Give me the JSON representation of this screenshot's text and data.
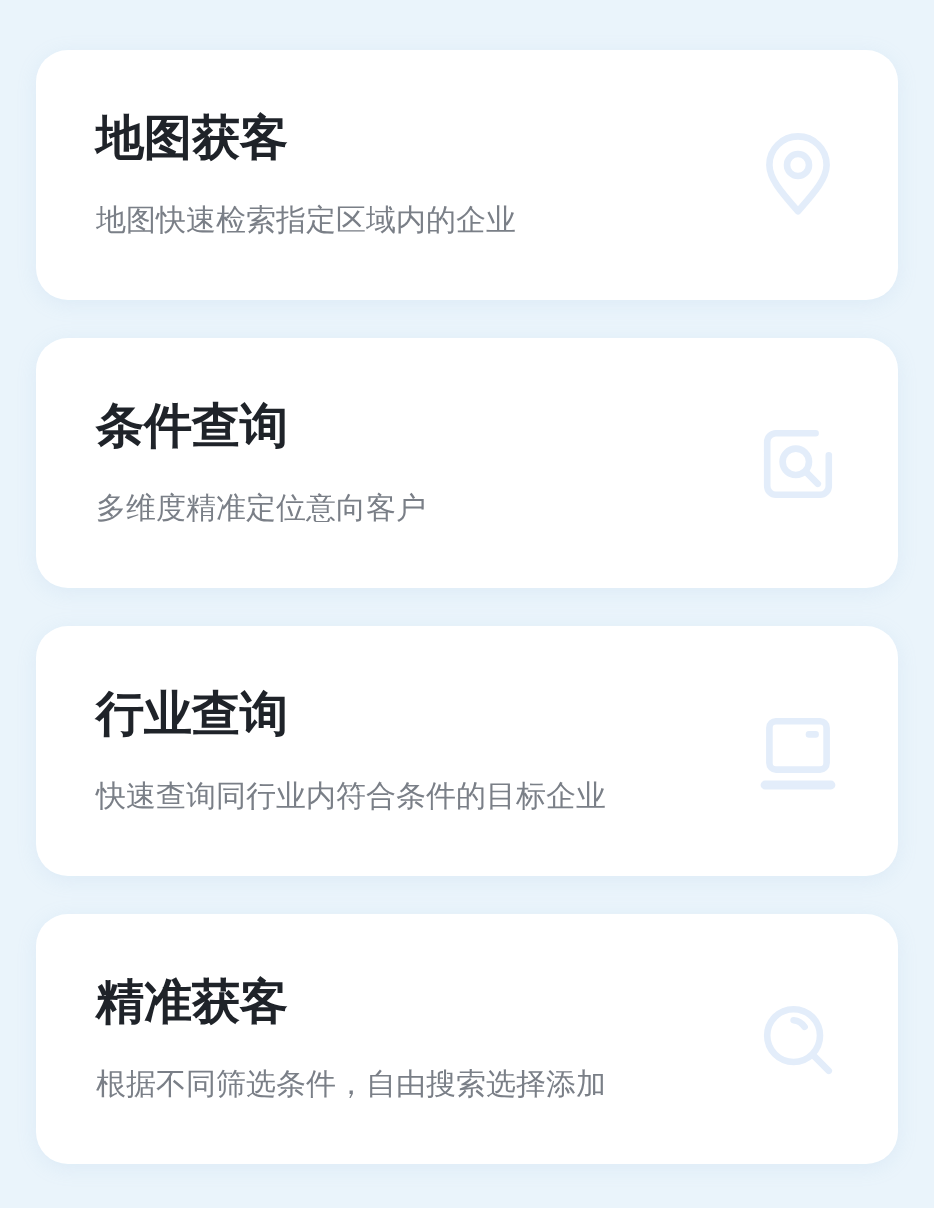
{
  "cards": [
    {
      "title": "地图获客",
      "subtitle": "地图快速检索指定区域内的企业",
      "kind": "pin"
    },
    {
      "title": "条件查询",
      "subtitle": "多维度精准定位意向客户",
      "kind": "frame-search"
    },
    {
      "title": "行业查询",
      "subtitle": "快速查询同行业内符合条件的目标企业",
      "kind": "monitor"
    },
    {
      "title": "精准获客",
      "subtitle": "根据不同筛选条件，自由搜索选择添加",
      "kind": "search"
    }
  ]
}
